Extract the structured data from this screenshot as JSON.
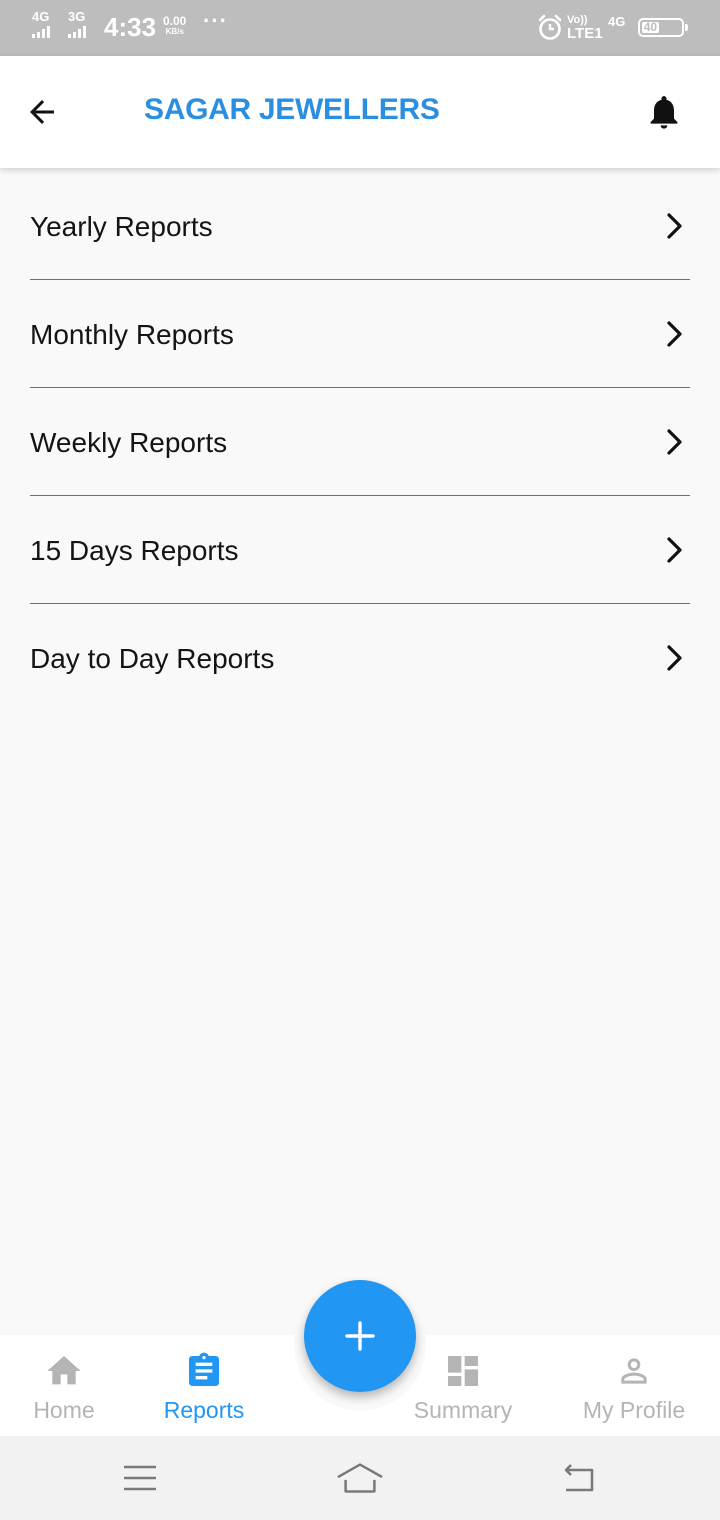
{
  "status_bar": {
    "network1": "4G",
    "network2": "3G",
    "time": "4:33",
    "data_speed": "0.00",
    "data_unit": "KB/s",
    "more": "···",
    "volte_top": "Vo))",
    "volte_bottom": "LTE1",
    "network3": "4G",
    "battery_level": "40",
    "icons": [
      "signal-icon",
      "alarm-icon",
      "battery-icon"
    ]
  },
  "app_bar": {
    "title": "SAGAR JEWELLERS",
    "title_color": "#2a8fe0",
    "back_icon": "arrow-left-icon",
    "notification_icon": "bell-icon"
  },
  "reports": {
    "items": [
      {
        "label": "Yearly Reports"
      },
      {
        "label": "Monthly Reports"
      },
      {
        "label": "Weekly Reports"
      },
      {
        "label": "15 Days Reports"
      },
      {
        "label": "Day to Day Reports"
      }
    ],
    "chevron_icon": "chevron-right-icon"
  },
  "bottom_nav": {
    "items": [
      {
        "label": "Home",
        "icon": "home-icon",
        "active": false
      },
      {
        "label": "Reports",
        "icon": "clipboard-icon",
        "active": true
      },
      {
        "label": "Summary",
        "icon": "dashboard-icon",
        "active": false
      },
      {
        "label": "My Profile",
        "icon": "person-icon",
        "active": false
      }
    ],
    "fab_icon": "plus-icon",
    "active_color": "#2196f3",
    "inactive_color": "#b4b4b4"
  },
  "system_nav": {
    "icons": [
      "menu-icon",
      "home-outline-icon",
      "back-return-icon"
    ]
  }
}
